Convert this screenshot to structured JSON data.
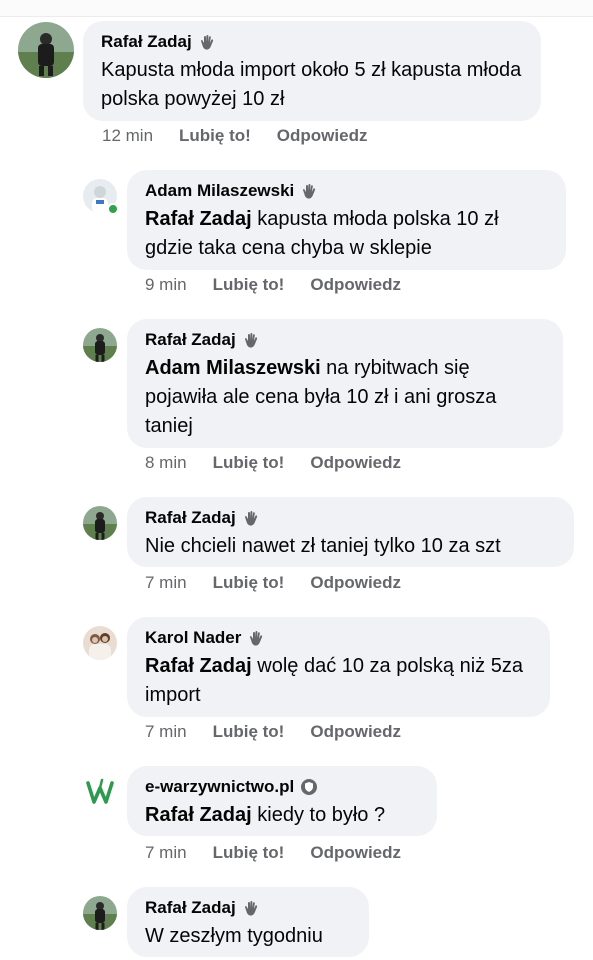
{
  "comments": [
    {
      "author": "Rafał Zadaj",
      "mention": "",
      "text": "Kapusta młoda import około 5 zł kapusta młoda polska powyżej 10 zł",
      "time": "12 min",
      "like": "Lubię to!",
      "reply": "Odpowiedz"
    },
    {
      "author": "Adam Milaszewski",
      "mention": "Rafał Zadaj",
      "text": " kapusta młoda polska 10 zł gdzie taka cena chyba w sklepie",
      "time": "9 min",
      "like": "Lubię to!",
      "reply": "Odpowiedz"
    },
    {
      "author": "Rafał Zadaj",
      "mention": "Adam Milaszewski",
      "text": " na rybitwach się pojawiła ale cena była 10 zł i ani grosza taniej",
      "time": "8 min",
      "like": "Lubię to!",
      "reply": "Odpowiedz"
    },
    {
      "author": "Rafał Zadaj",
      "mention": "",
      "text": "Nie chcieli nawet zł taniej tylko 10 za szt",
      "time": "7 min",
      "like": "Lubię to!",
      "reply": "Odpowiedz"
    },
    {
      "author": "Karol Nader",
      "mention": "Rafał Zadaj",
      "text": " wolę dać 10 za polską niż 5za import",
      "time": "7 min",
      "like": "Lubię to!",
      "reply": "Odpowiedz"
    },
    {
      "author": "e-warzywnictwo.pl",
      "mention": "Rafał Zadaj",
      "text": " kiedy to było ?",
      "time": "7 min",
      "like": "Lubię to!",
      "reply": "Odpowiedz"
    },
    {
      "author": "Rafał Zadaj",
      "mention": "",
      "text": "W zeszłym tygodniu",
      "time": "",
      "like": "",
      "reply": ""
    }
  ],
  "icons": {
    "wave_badge": "waving-hand-icon",
    "page_badge": "shield-badge-icon"
  },
  "colors": {
    "bubble": "#f0f2f5",
    "meta": "#65676b",
    "online": "#31a24c",
    "brand_w": "#2e9a4f"
  }
}
